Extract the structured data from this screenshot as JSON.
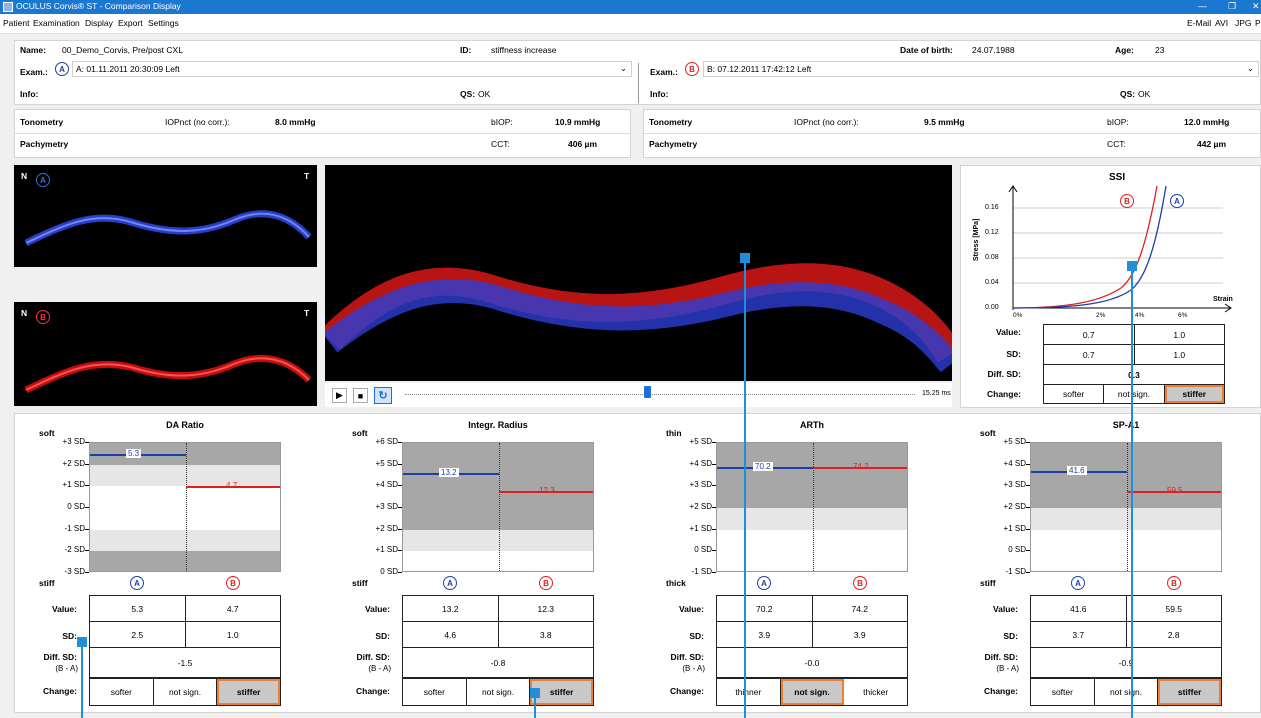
{
  "window": {
    "title": "OCULUS Corvis® ST - Comparison Display"
  },
  "menu": {
    "items": [
      "Patient",
      "Examination",
      "Display",
      "Export",
      "Settings"
    ],
    "right": [
      "E-Mail",
      "AVI",
      "JPG",
      "P"
    ]
  },
  "patient": {
    "name_label": "Name:",
    "name": "00_Demo_Corvis, Pre/post CXL",
    "id_label": "ID:",
    "id": "stiffness increase",
    "dob_label": "Date of birth:",
    "dob": "24.07.1988",
    "age_label": "Age:",
    "age": "23"
  },
  "examA": {
    "exam_label": "Exam.:",
    "badge": "A",
    "selection": "A: 01.11.2011     20:30:09     Left",
    "info_label": "Info:",
    "qs_label": "QS:",
    "qs": "OK",
    "tono_label": "Tonometry",
    "iop_label": "IOPnct (no corr.):",
    "iop": "8.0 mmHg",
    "biop_label": "bIOP:",
    "biop": "10.9 mmHg",
    "pachy_label": "Pachymetry",
    "cct_label": "CCT:",
    "cct": "406 µm"
  },
  "examB": {
    "exam_label": "Exam.:",
    "badge": "B",
    "selection": "B: 07.12.2011     17:42:12     Left",
    "info_label": "Info:",
    "qs_label": "QS:",
    "qs": "OK",
    "tono_label": "Tonometry",
    "iop_label": "IOPnct (no corr.):",
    "iop": "9.5 mmHg",
    "biop_label": "bIOP:",
    "biop": "12.0 mmHg",
    "pachy_label": "Pachymetry",
    "cct_label": "CCT:",
    "cct": "442 µm"
  },
  "images": {
    "n": "N",
    "t": "T",
    "a": "A",
    "b": "B",
    "time": "15.25 ms"
  },
  "ssi": {
    "title": "SSI",
    "ylabel": "Stress [MPa]",
    "xlabel": "Strain",
    "yticks": [
      "0.16",
      "0.12",
      "0.08",
      "0.04",
      "0.00"
    ],
    "xticks": [
      "0%",
      "2%",
      "4%",
      "6%"
    ],
    "a": "A",
    "b": "B",
    "value_label": "Value:",
    "value_a": "0.7",
    "value_b": "1.0",
    "sd_label": "SD:",
    "sd_a": "0.7",
    "sd_b": "1.0",
    "diff_label": "Diff. SD:",
    "diff": "0.3",
    "change_label": "Change:",
    "changes": [
      "softer",
      "not sign.",
      "stiffer"
    ],
    "selected": 2
  },
  "chart_data": [
    {
      "type": "gauge",
      "title": "DA Ratio",
      "top_label": "soft",
      "bottom_label": "stiff",
      "yticks": [
        "+3 SD",
        "+2 SD",
        "+1 SD",
        "0 SD",
        "-1 SD",
        "-2 SD",
        "-3 SD"
      ],
      "ylim": [
        -3,
        3
      ],
      "a": 5.3,
      "b": 4.7,
      "a_sd": 2.5,
      "b_sd": 1.0
    },
    {
      "type": "gauge",
      "title": "Integr. Radius",
      "top_label": "soft",
      "bottom_label": "stiff",
      "yticks": [
        "+6 SD",
        "+5 SD",
        "+4 SD",
        "+3 SD",
        "+2 SD",
        "+1 SD",
        "0 SD"
      ],
      "ylim": [
        0,
        6
      ],
      "a": 13.2,
      "b": 12.3,
      "a_sd": 4.6,
      "b_sd": 3.8
    },
    {
      "type": "gauge",
      "title": "ARTh",
      "top_label": "thin",
      "bottom_label": "thick",
      "yticks": [
        "+5 SD",
        "+4 SD",
        "+3 SD",
        "+2 SD",
        "+1 SD",
        "0 SD",
        "-1 SD"
      ],
      "ylim": [
        -1,
        5
      ],
      "a": 70.2,
      "b": 74.2,
      "a_sd": 3.9,
      "b_sd": 3.9
    },
    {
      "type": "gauge",
      "title": "SP-A1",
      "top_label": "soft",
      "bottom_label": "stiff",
      "yticks": [
        "+5 SD",
        "+4 SD",
        "+3 SD",
        "+2 SD",
        "+1 SD",
        "0 SD",
        "-1 SD"
      ],
      "ylim": [
        -1,
        5
      ],
      "a": 41.6,
      "b": 59.5,
      "a_sd": 3.7,
      "b_sd": 2.8
    }
  ],
  "params": [
    {
      "a": "A",
      "b": "B",
      "value_label": "Value:",
      "value_a": "5.3",
      "value_b": "4.7",
      "sd_label": "SD:",
      "sd_a": "2.5",
      "sd_b": "1.0",
      "diff_label": "Diff. SD:",
      "diff_sub": "(B - A)",
      "diff": "-1.5",
      "change_label": "Change:",
      "changes": [
        "softer",
        "not sign.",
        "stiffer"
      ],
      "selected": 2
    },
    {
      "a": "A",
      "b": "B",
      "value_label": "Value:",
      "value_a": "13.2",
      "value_b": "12.3",
      "sd_label": "SD:",
      "sd_a": "4.6",
      "sd_b": "3.8",
      "diff_label": "Diff. SD:",
      "diff_sub": "(B - A)",
      "diff": "-0.8",
      "change_label": "Change:",
      "changes": [
        "softer",
        "not sign.",
        "stiffer"
      ],
      "selected": 2
    },
    {
      "a": "A",
      "b": "B",
      "value_label": "Value:",
      "value_a": "70.2",
      "value_b": "74.2",
      "sd_label": "SD:",
      "sd_a": "3.9",
      "sd_b": "3.9",
      "diff_label": "Diff. SD:",
      "diff_sub": "(B - A)",
      "diff": "-0.0",
      "change_label": "Change:",
      "changes": [
        "thinner",
        "not sign.",
        "thicker"
      ],
      "selected": 1
    },
    {
      "a": "A",
      "b": "B",
      "value_label": "Value:",
      "value_a": "41.6",
      "value_b": "59.5",
      "sd_label": "SD:",
      "sd_a": "3.7",
      "sd_b": "2.8",
      "diff_label": "Diff. SD:",
      "diff_sub": "(B - A)",
      "diff": "-0.9",
      "change_label": "Change:",
      "changes": [
        "softer",
        "not sign.",
        "stiffer"
      ],
      "selected": 2
    }
  ],
  "colors": {
    "a": "#1f3fa8",
    "b": "#e02020",
    "accent": "#ef7d33",
    "annot": "#1e8fd8"
  }
}
